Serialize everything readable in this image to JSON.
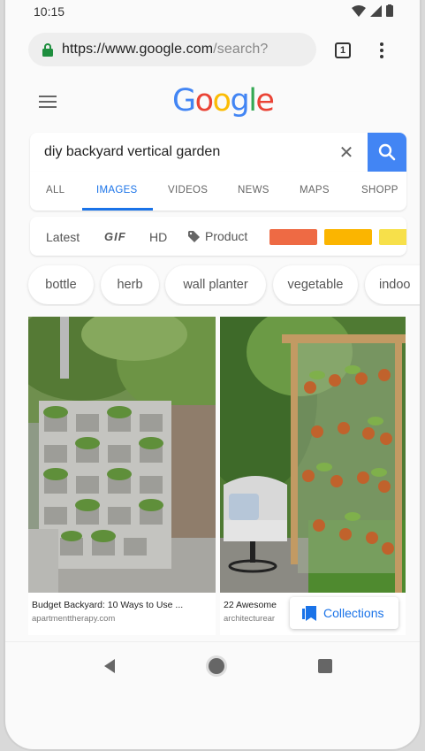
{
  "status_bar": {
    "time": "10:15"
  },
  "browser": {
    "url_host": "https://www.google.com",
    "url_path": "/search?",
    "tab_count": "1"
  },
  "google": {
    "logo_letters": [
      {
        "char": "G",
        "color": "#4285F4"
      },
      {
        "char": "o",
        "color": "#EA4335"
      },
      {
        "char": "o",
        "color": "#FBBC05"
      },
      {
        "char": "g",
        "color": "#4285F4"
      },
      {
        "char": "l",
        "color": "#34A853"
      },
      {
        "char": "e",
        "color": "#EA4335"
      }
    ]
  },
  "search": {
    "query": "diy backyard vertical garden"
  },
  "tabs": [
    {
      "label": "ALL",
      "active": false
    },
    {
      "label": "IMAGES",
      "active": true
    },
    {
      "label": "VIDEOS",
      "active": false
    },
    {
      "label": "NEWS",
      "active": false
    },
    {
      "label": "MAPS",
      "active": false
    },
    {
      "label": "SHOPP",
      "active": false
    }
  ],
  "filters": {
    "latest": "Latest",
    "gif": "GIF",
    "hd": "HD",
    "product": "Product",
    "color_swatches": [
      "#EE6A44",
      "#FBB500",
      "#F7E04A"
    ]
  },
  "chips": [
    "bottle",
    "herb",
    "wall planter",
    "vegetable",
    "indoo"
  ],
  "results": [
    {
      "title": "Budget Backyard: 10 Ways to Use ...",
      "source": "apartmenttherapy.com"
    },
    {
      "title": "22 Awesome",
      "source": "architecturear"
    }
  ],
  "collections": {
    "label": "Collections"
  },
  "accent_color": "#1A73E8"
}
